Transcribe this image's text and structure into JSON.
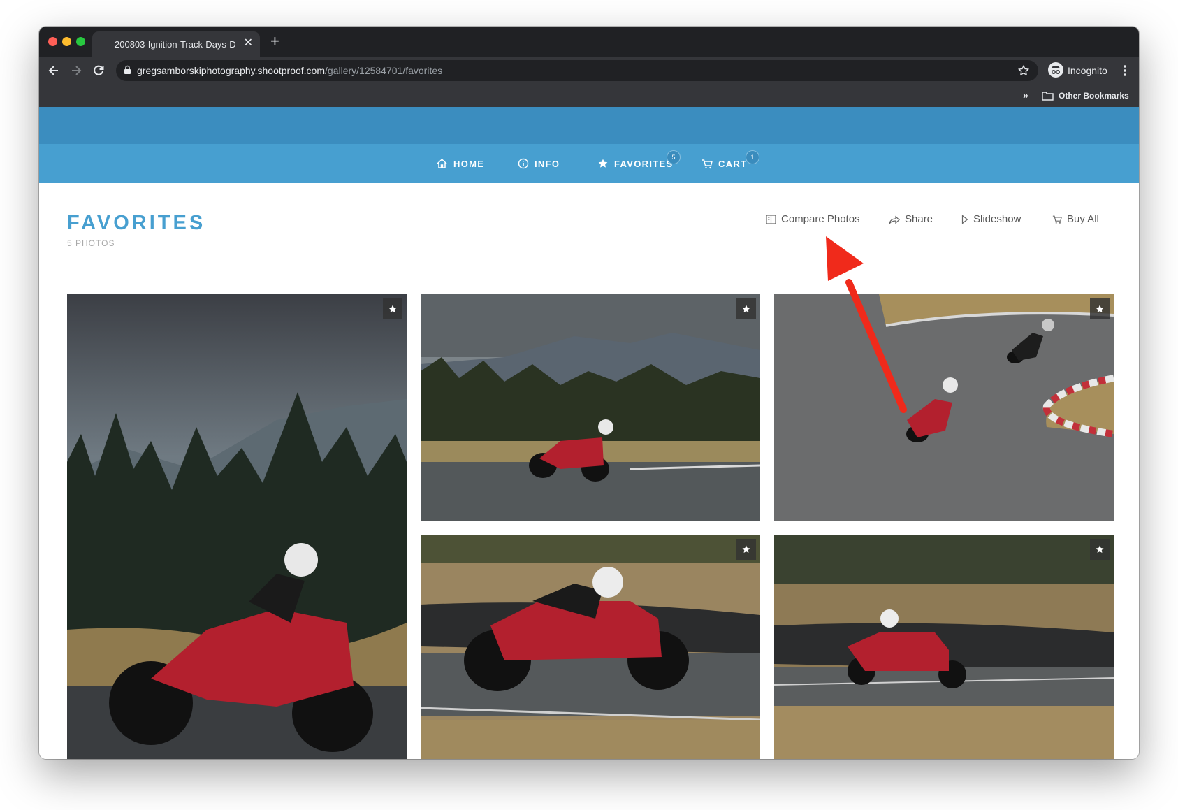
{
  "browser": {
    "tab_title": "200803-Ignition-Track-Days-D",
    "url_host": "gregsamborskiphotography.shootproof.com",
    "url_path": "/gallery/12584701/favorites",
    "profile_label": "Incognito",
    "bookmarks_chevron": "»",
    "bookmarks_folder": "Other Bookmarks"
  },
  "nav": {
    "items": [
      {
        "label": "HOME",
        "icon": "home-icon"
      },
      {
        "label": "INFO",
        "icon": "info-icon"
      },
      {
        "label": "FAVORITES",
        "icon": "star-icon",
        "badge": "5"
      },
      {
        "label": "CART",
        "icon": "cart-icon",
        "badge": "1"
      }
    ]
  },
  "page": {
    "title": "FAVORITES",
    "subtitle": "5 PHOTOS",
    "actions": [
      {
        "label": "Compare Photos",
        "icon": "compare-icon"
      },
      {
        "label": "Share",
        "icon": "share-icon"
      },
      {
        "label": "Slideshow",
        "icon": "play-icon"
      },
      {
        "label": "Buy All",
        "icon": "cart-icon"
      }
    ]
  },
  "photos": [
    {
      "subject": "red motorcycle leaning hard, tree-lined backdrop",
      "favorited": true
    },
    {
      "subject": "red motorcycle on track with mountains behind",
      "favorited": true
    },
    {
      "subject": "two riders cornering on asphalt",
      "favorited": true
    },
    {
      "subject": "red motorcycle passing, motion blur",
      "favorited": true
    },
    {
      "subject": "red motorcycle on straight, panned background",
      "favorited": true
    }
  ],
  "colors": {
    "brand_blue": "#479fd0",
    "hero_blue": "#3b8dbf",
    "chrome_dark": "#202124",
    "chrome_toolbar": "#35363a",
    "annotation_red": "#f02a1b"
  }
}
